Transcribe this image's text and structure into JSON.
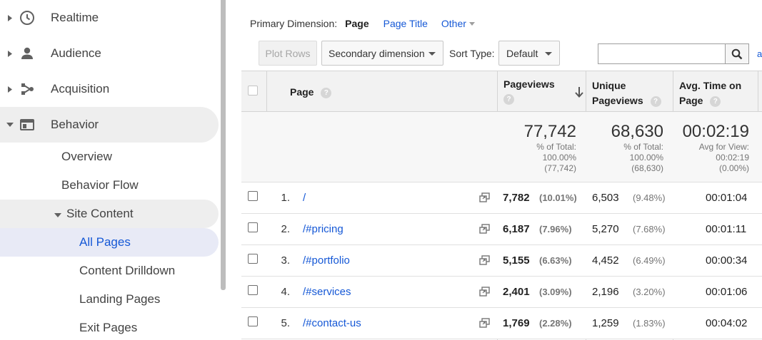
{
  "sidebar": {
    "top_items": [
      {
        "label": "Realtime",
        "icon": "clock-icon"
      },
      {
        "label": "Audience",
        "icon": "person-icon"
      },
      {
        "label": "Acquisition",
        "icon": "acquisition-icon"
      },
      {
        "label": "Behavior",
        "icon": "behavior-icon",
        "expanded": true
      }
    ],
    "behavior_items": [
      {
        "label": "Overview"
      },
      {
        "label": "Behavior Flow"
      }
    ],
    "site_content": {
      "label": "Site Content",
      "items": [
        {
          "label": "All Pages",
          "selected": true
        },
        {
          "label": "Content Drilldown"
        },
        {
          "label": "Landing Pages"
        },
        {
          "label": "Exit Pages"
        }
      ]
    }
  },
  "primary_dimension": {
    "label": "Primary Dimension:",
    "active": "Page",
    "options": [
      "Page Title",
      "Other"
    ]
  },
  "toolbar": {
    "plot_rows": "Plot Rows",
    "secondary_dimension": "Secondary dimension",
    "sort_type_label": "Sort Type:",
    "sort_type_value": "Default",
    "search_value": "",
    "advanced_link": "a"
  },
  "table": {
    "headers": {
      "page": "Page",
      "pageviews": "Pageviews",
      "unique_pageviews": "Unique Pageviews",
      "unique_line1": "Unique",
      "unique_line2": "Pageviews",
      "avg_time": "Avg. Time on Page",
      "avg_line1": "Avg. Time on",
      "avg_line2": "Page"
    },
    "totals": {
      "pageviews": {
        "value": "77,742",
        "line1": "% of Total:",
        "line2": "100.00%",
        "line3": "(77,742)"
      },
      "unique_pageviews": {
        "value": "68,630",
        "line1": "% of Total:",
        "line2": "100.00%",
        "line3": "(68,630)"
      },
      "avg_time": {
        "value": "00:02:19",
        "line1": "Avg for View:",
        "line2": "00:02:19",
        "line3": "(0.00%)"
      }
    },
    "rows": [
      {
        "num": "1.",
        "page": "/",
        "pageviews": "7,782",
        "pageviews_pct": "(10.01%)",
        "unique": "6,503",
        "unique_pct": "(9.48%)",
        "avg_time": "00:01:04"
      },
      {
        "num": "2.",
        "page": "/#pricing",
        "pageviews": "6,187",
        "pageviews_pct": "(7.96%)",
        "unique": "5,270",
        "unique_pct": "(7.68%)",
        "avg_time": "00:01:11"
      },
      {
        "num": "3.",
        "page": "/#portfolio",
        "pageviews": "5,155",
        "pageviews_pct": "(6.63%)",
        "unique": "4,452",
        "unique_pct": "(6.49%)",
        "avg_time": "00:00:34"
      },
      {
        "num": "4.",
        "page": "/#services",
        "pageviews": "2,401",
        "pageviews_pct": "(3.09%)",
        "unique": "2,196",
        "unique_pct": "(3.20%)",
        "avg_time": "00:01:06"
      },
      {
        "num": "5.",
        "page": "/#contact-us",
        "pageviews": "1,769",
        "pageviews_pct": "(2.28%)",
        "unique": "1,259",
        "unique_pct": "(1.83%)",
        "avg_time": "00:04:02"
      }
    ]
  },
  "colors": {
    "link": "#1558d6",
    "selected_bg": "#e8eaf6",
    "header_bg": "#f2f2f2"
  }
}
